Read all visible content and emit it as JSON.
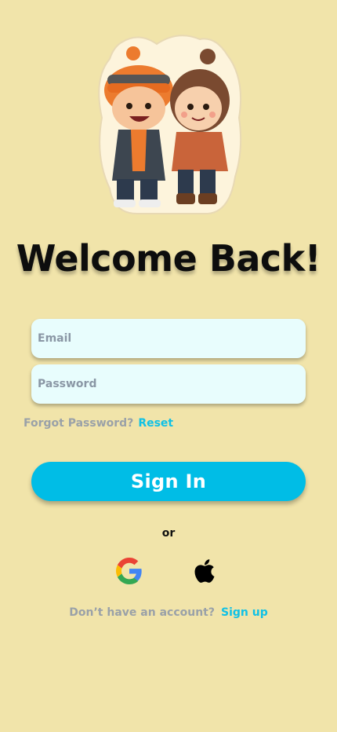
{
  "title": "Welcome Back!",
  "email": {
    "placeholder": "Email"
  },
  "password": {
    "placeholder": "Password"
  },
  "forgot": {
    "label": "Forgot Password?",
    "link": "Reset"
  },
  "signin": {
    "label": "Sign In"
  },
  "divider": "or",
  "social": {
    "google_icon": "google-icon",
    "apple_icon": "apple-icon"
  },
  "signup": {
    "label": "Don’t have an account?",
    "link": "Sign up"
  },
  "colors": {
    "background": "#f1e4aa",
    "field_bg": "#e8fdfd",
    "accent": "#00bde6",
    "link": "#10c1e6",
    "muted": "#9aa1a8",
    "title": "#0d0d0d"
  }
}
